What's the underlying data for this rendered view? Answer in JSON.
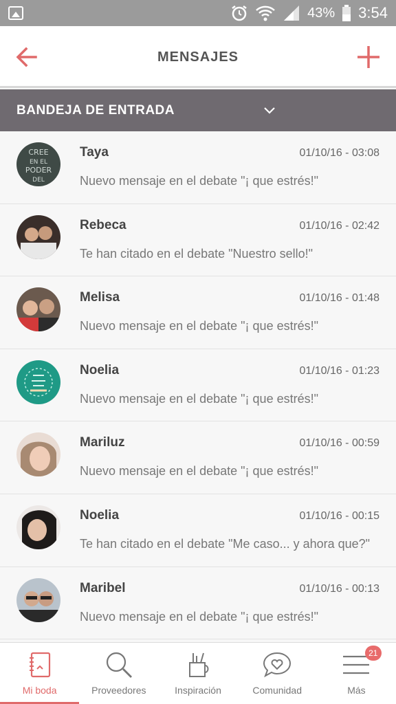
{
  "status_bar": {
    "battery_percent": "43%",
    "time": "3:54",
    "icons": [
      "gallery-icon",
      "alarm-icon",
      "wifi-icon",
      "signal-icon",
      "battery-icon"
    ]
  },
  "header": {
    "title": "MENSAJES",
    "back_icon": "arrow-left-icon",
    "add_icon": "plus-icon",
    "accent": "#e06a6a"
  },
  "inbox": {
    "label": "BANDEJA DE ENTRADA",
    "chevron_icon": "chevron-down-icon",
    "bar_color": "#6f6a70"
  },
  "messages": [
    {
      "sender": "Taya",
      "date": "01/10/16 - 03:08",
      "preview": "Nuevo mensaje en el debate \"¡ que estrés!\""
    },
    {
      "sender": "Rebeca",
      "date": "01/10/16 - 02:42",
      "preview": "Te han citado en el debate \"Nuestro sello!\""
    },
    {
      "sender": "Melisa",
      "date": "01/10/16 - 01:48",
      "preview": "Nuevo mensaje en el debate \"¡ que estrés!\""
    },
    {
      "sender": "Noelia",
      "date": "01/10/16 - 01:23",
      "preview": "Nuevo mensaje en el debate \"¡ que estrés!\""
    },
    {
      "sender": "Mariluz",
      "date": "01/10/16 - 00:59",
      "preview": "Nuevo mensaje en el debate \"¡ que estrés!\""
    },
    {
      "sender": "Noelia",
      "date": "01/10/16 - 00:15",
      "preview": "Te han citado en el debate \"Me caso... y ahora que?\""
    },
    {
      "sender": "Maribel",
      "date": "01/10/16 - 00:13",
      "preview": "Nuevo mensaje en el debate \"¡ que estrés!\""
    }
  ],
  "bottom_nav": {
    "items": [
      {
        "label": "Mi boda",
        "icon": "notebook-icon",
        "active": true
      },
      {
        "label": "Proveedores",
        "icon": "search-icon",
        "active": false
      },
      {
        "label": "Inspiración",
        "icon": "pencil-cup-icon",
        "active": false
      },
      {
        "label": "Comunidad",
        "icon": "heart-chat-icon",
        "active": false
      },
      {
        "label": "Más",
        "icon": "menu-icon",
        "active": false,
        "badge": "21"
      }
    ]
  }
}
